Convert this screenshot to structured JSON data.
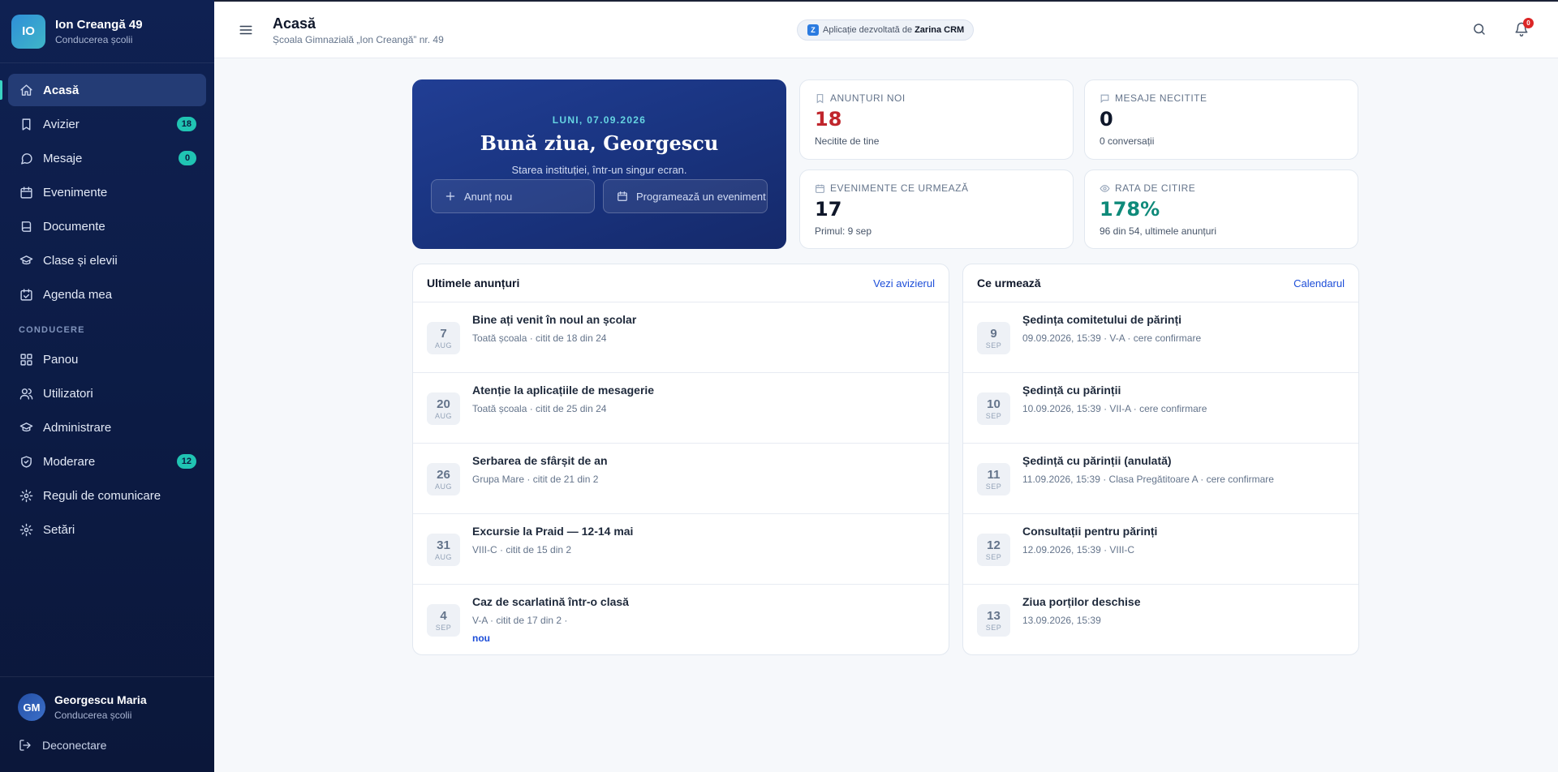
{
  "sidebar": {
    "logo": "IO",
    "school_name": "Ion Creangă 49",
    "school_role": "Conducerea școlii",
    "items": [
      {
        "label": "Acasă"
      },
      {
        "label": "Avizier",
        "badge": "18"
      },
      {
        "label": "Mesaje",
        "badge": "0"
      },
      {
        "label": "Evenimente"
      },
      {
        "label": "Documente"
      },
      {
        "label": "Clase și elevii"
      },
      {
        "label": "Agenda mea"
      }
    ],
    "section_label": "CONDUCERE",
    "admin_items": [
      {
        "label": "Panou"
      },
      {
        "label": "Utilizatori"
      },
      {
        "label": "Administrare"
      },
      {
        "label": "Moderare",
        "badge": "12"
      },
      {
        "label": "Reguli de comunicare"
      },
      {
        "label": "Setări"
      }
    ],
    "user": {
      "initials": "GM",
      "name": "Georgescu Maria",
      "role": "Conducerea școlii"
    },
    "logout_label": "Deconectare"
  },
  "header": {
    "title": "Acasă",
    "subtitle": "Școala Gimnazială „Ion Creangă” nr. 49",
    "dev_logo": "Z",
    "dev_text": "Aplicație dezvoltată de",
    "dev_brand": "Zarina CRM",
    "notif_count": "0"
  },
  "hero": {
    "date": "LUNI, 07.09.2026",
    "greeting": "Bună ziua, Georgescu",
    "subtitle": "Starea instituției, într-un singur ecran.",
    "btn_new_announcement": "Anunț nou",
    "btn_schedule_event": "Programează un eveniment"
  },
  "stats": {
    "announcements": {
      "label": "ANUNȚURI NOI",
      "value": "18",
      "note": "Necitite de tine",
      "color": "#c0262d"
    },
    "messages": {
      "label": "MESAJE NECITITE",
      "value": "0",
      "note": "0 conversații",
      "color": "#0f172a"
    },
    "events": {
      "label": "EVENIMENTE CE URMEAZĂ",
      "value": "17",
      "note": "Primul: 9 sep",
      "color": "#0f172a"
    },
    "read_rate": {
      "label": "RATA DE CITIRE",
      "value": "178%",
      "note": "96 din 54, ultimele anunțuri",
      "color": "#0f8a7a"
    }
  },
  "announcements": {
    "title": "Ultimele anunțuri",
    "link": "Vezi avizierul",
    "items": [
      {
        "day": "7",
        "month": "AUG",
        "title": "Bine ați venit în noul an școlar",
        "meta": "Toată școala · citit de 18 din 24"
      },
      {
        "day": "20",
        "month": "AUG",
        "title": "Atenție la aplicațiile de mesagerie",
        "meta": "Toată școala · citit de 25 din 24"
      },
      {
        "day": "26",
        "month": "AUG",
        "title": "Serbarea de sfârșit de an",
        "meta": "Grupa Mare · citit de 21 din 2"
      },
      {
        "day": "31",
        "month": "AUG",
        "title": "Excursie la Praid — 12-14 mai",
        "meta": "VIII-C · citit de 15 din 2"
      },
      {
        "day": "4",
        "month": "SEP",
        "title": "Caz de scarlatină într-o clasă",
        "meta": "V-A · citit de 17 din 2 ·",
        "tag": "nou"
      }
    ]
  },
  "upcoming": {
    "title": "Ce urmează",
    "link": "Calendarul",
    "items": [
      {
        "day": "9",
        "month": "SEP",
        "title": "Ședința comitetului de părinți",
        "meta": "09.09.2026, 15:39 · V-A · cere confirmare"
      },
      {
        "day": "10",
        "month": "SEP",
        "title": "Ședință cu părinții",
        "meta": "10.09.2026, 15:39 · VII-A · cere confirmare"
      },
      {
        "day": "11",
        "month": "SEP",
        "title": "Ședință cu părinții (anulată)",
        "meta": "11.09.2026, 15:39 · Clasa Pregătitoare A · cere confirmare"
      },
      {
        "day": "12",
        "month": "SEP",
        "title": "Consultații pentru părinți",
        "meta": "12.09.2026, 15:39 · VIII-C"
      },
      {
        "day": "13",
        "month": "SEP",
        "title": "Ziua porților deschise",
        "meta": "13.09.2026, 15:39"
      }
    ]
  }
}
